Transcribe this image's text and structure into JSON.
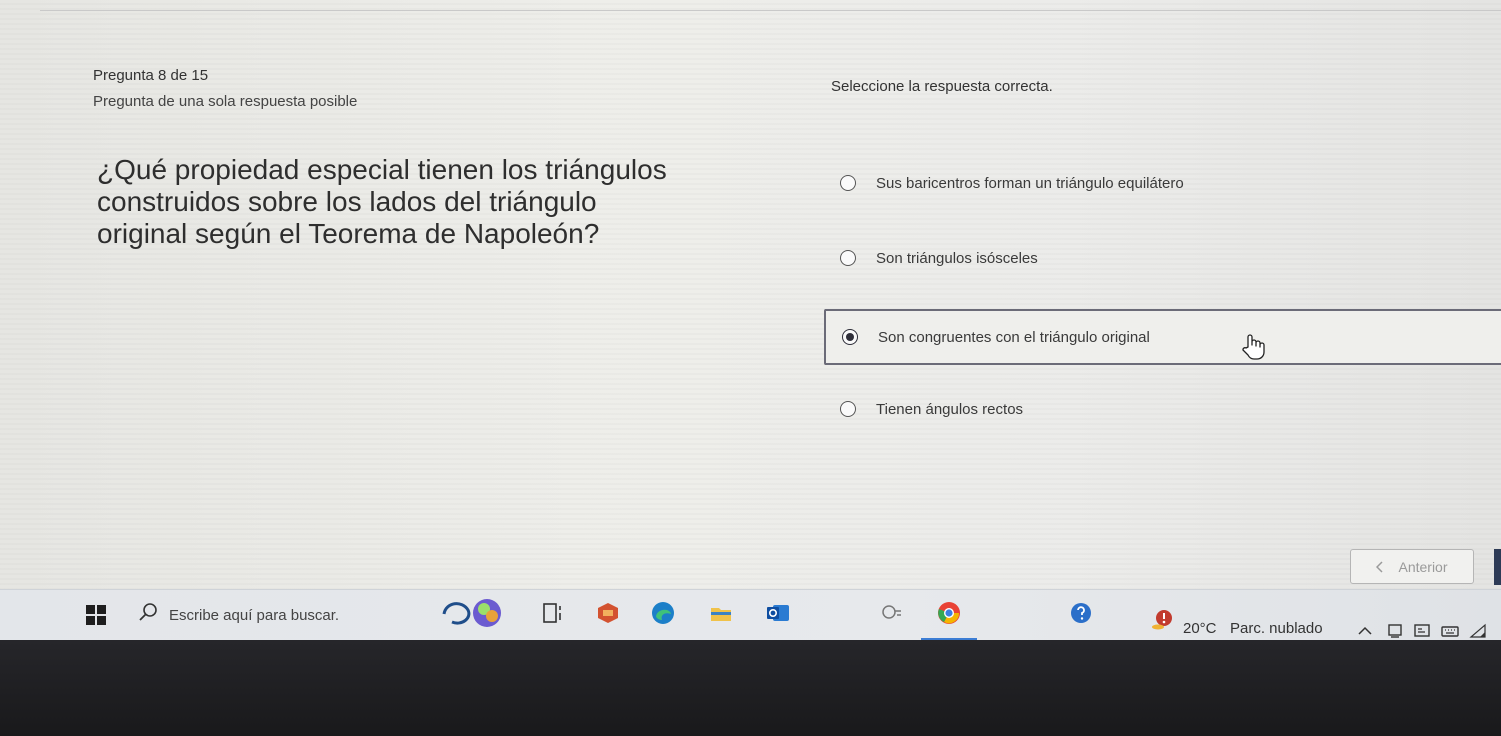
{
  "quiz": {
    "question_counter": "Pregunta 8 de 15",
    "question_type": "Pregunta de una sola respuesta posible",
    "question_text": "¿Qué propiedad especial tienen los triángulos construidos sobre los lados del triángulo original según el Teorema de Napoleón?",
    "instruction": "Seleccione la respuesta correcta.",
    "options": [
      {
        "label": "Sus baricentros forman un triángulo equilátero",
        "selected": false
      },
      {
        "label": "Son triángulos isósceles",
        "selected": false
      },
      {
        "label": "Son congruentes con el triángulo original",
        "selected": true
      },
      {
        "label": "Tienen ángulos rectos",
        "selected": false
      }
    ],
    "prev_button": {
      "label": "Anterior",
      "icon": "chevron-left-icon"
    }
  },
  "taskbar": {
    "search_placeholder": "Escribe aquí para buscar.",
    "apps": [
      "copilot-icon",
      "task-view-icon",
      "office-icon",
      "edge-icon",
      "file-explorer-icon",
      "outlook-icon",
      "search-widget-icon",
      "chrome-icon",
      "help-icon"
    ],
    "weather": {
      "temp": "20°C",
      "condition": "Parc. nublado"
    },
    "tray": [
      "chevron-up-icon",
      "network-icon",
      "display-icon",
      "keyboard-icon",
      "wifi-icon"
    ]
  }
}
